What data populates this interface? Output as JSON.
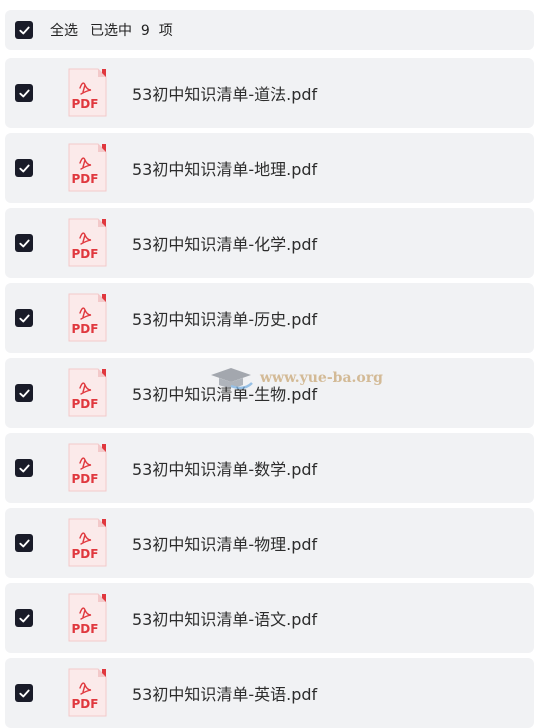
{
  "header": {
    "select_all_label": "全选",
    "selected_text": "已选中  9  项"
  },
  "files": [
    {
      "name": "53初中知识清单-道法.pdf"
    },
    {
      "name": "53初中知识清单-地理.pdf"
    },
    {
      "name": "53初中知识清单-化学.pdf"
    },
    {
      "name": "53初中知识清单-历史.pdf"
    },
    {
      "name": "53初中知识清单-生物.pdf"
    },
    {
      "name": "53初中知识清单-数学.pdf"
    },
    {
      "name": "53初中知识清单-物理.pdf"
    },
    {
      "name": "53初中知识清单-语文.pdf"
    },
    {
      "name": "53初中知识清单-英语.pdf"
    }
  ],
  "pdf_icon_label": "PDF",
  "watermark": "www.yue-ba.org",
  "colors": {
    "checkbox": "#1a1c29",
    "row_bg": "#f1f2f4",
    "pdf_red": "#e0383e"
  }
}
